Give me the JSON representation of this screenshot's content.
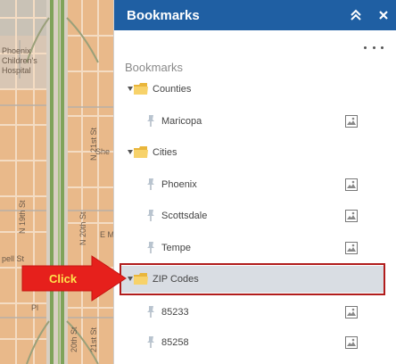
{
  "panel": {
    "title": "Bookmarks",
    "section_label": "Bookmarks",
    "header_color": "#1f5fa3"
  },
  "groups": [
    {
      "label": "Counties",
      "expanded": true,
      "items": [
        "Maricopa"
      ]
    },
    {
      "label": "Cities",
      "expanded": true,
      "items": [
        "Phoenix",
        "Scottsdale",
        "Tempe"
      ]
    },
    {
      "label": "ZIP Codes",
      "expanded": true,
      "highlighted": true,
      "items": [
        "85233",
        "85258"
      ]
    }
  ],
  "callout": {
    "text": "Click",
    "arrow_color": "#e6201c",
    "text_color": "#ffe44d",
    "highlight_color": "#b11c1c"
  },
  "map": {
    "labels": {
      "poster_1": "Phoenix",
      "poster_2": "Children's",
      "poster_3": "Hospital",
      "street_n21": "N 21st St",
      "street_n19": "N 19th St",
      "street_n20": "N 20th St",
      "street_e_m": "E M",
      "street_she": "She",
      "street_pell": "pell St",
      "street_21st": "21st St",
      "street_20th": "20th St",
      "street_pl": "Pl"
    },
    "base_color": "#e9b98a",
    "highway_color": "#7fa35a"
  },
  "icons": {
    "collapse": "double-chevron-up-icon",
    "close": "close-icon",
    "more": "more-horizontal-icon",
    "folder": "folder-icon",
    "pin": "pushpin-icon",
    "thumbnail": "image-thumbnail-icon"
  }
}
